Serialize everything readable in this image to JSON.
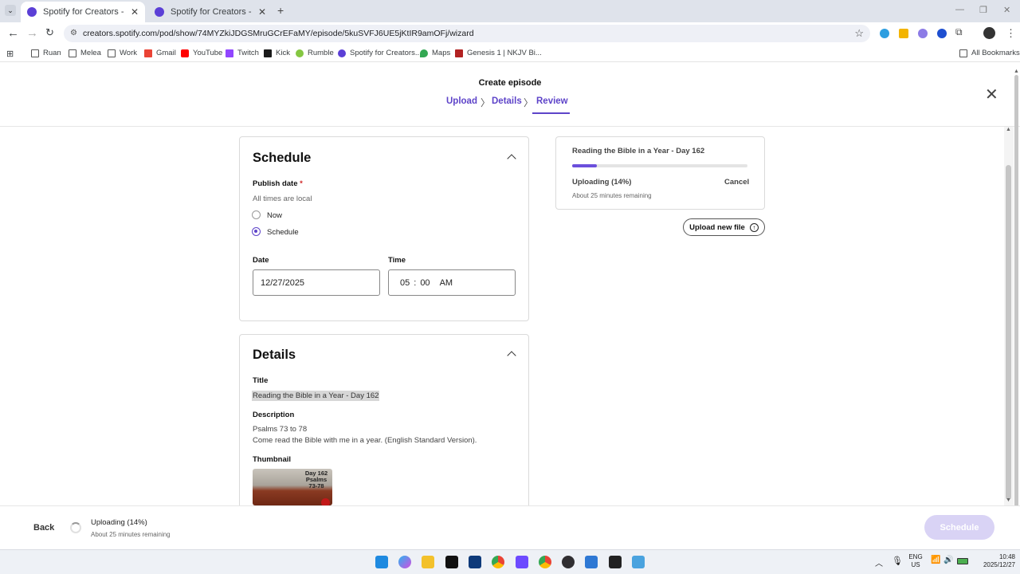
{
  "browser": {
    "tabs": [
      {
        "title": "Spotify for Creators - The easie"
      },
      {
        "title": "Spotify for Creators - The easie"
      }
    ],
    "url": "creators.spotify.com/pod/show/74MYZkiJDGSMruGCrEFaMY/episode/5kuSVFJ6UE5jKtIR9amOFj/wizard",
    "bookmarks": [
      "Ruan",
      "Melea",
      "Work",
      "Gmail",
      "YouTube",
      "Twitch",
      "Kick",
      "Rumble",
      "Spotify for Creators...",
      "Maps",
      "Genesis 1 | NKJV Bi..."
    ],
    "all_bookmarks": "All Bookmarks"
  },
  "header": {
    "title": "Create episode",
    "steps": [
      "Upload",
      "Details",
      "Review"
    ],
    "active_step": "Review"
  },
  "schedule": {
    "heading": "Schedule",
    "publish_label": "Publish date",
    "required_mark": "*",
    "times_note": "All times are local",
    "options": [
      "Now",
      "Schedule"
    ],
    "selected": "Schedule",
    "date_label": "Date",
    "date_value": "12/27/2025",
    "time_label": "Time",
    "time_hour": "05",
    "time_sep": ":",
    "time_minute": "00",
    "time_ampm": "AM"
  },
  "details": {
    "heading": "Details",
    "title_label": "Title",
    "title_value": "Reading the Bible in a Year - Day 162",
    "description_label": "Description",
    "description_line1": "Psalms 73 to 78",
    "description_line2": "Come read the Bible with me in a year. (English Standard Version).",
    "thumbnail_label": "Thumbnail",
    "thumbnail_text1": "Day 162",
    "thumbnail_text2": "Psalms",
    "thumbnail_text3": "73-78"
  },
  "upload": {
    "file_title": "Reading the Bible in a Year - Day 162",
    "status": "Uploading (14%)",
    "progress": 0.14,
    "remaining": "About 25 minutes remaining",
    "cancel": "Cancel",
    "new_file": "Upload new file"
  },
  "footer": {
    "back": "Back",
    "status": "Uploading (14%)",
    "remaining": "About 25 minutes remaining",
    "schedule_button": "Schedule"
  },
  "taskbar": {
    "lang": "ENG",
    "region": "US",
    "time": "10:48",
    "date": "2025/12/27"
  },
  "colors": {
    "accent": "#5e44c9",
    "progress": "#6b4fdc",
    "disabled_button": "#d9d3f5"
  }
}
